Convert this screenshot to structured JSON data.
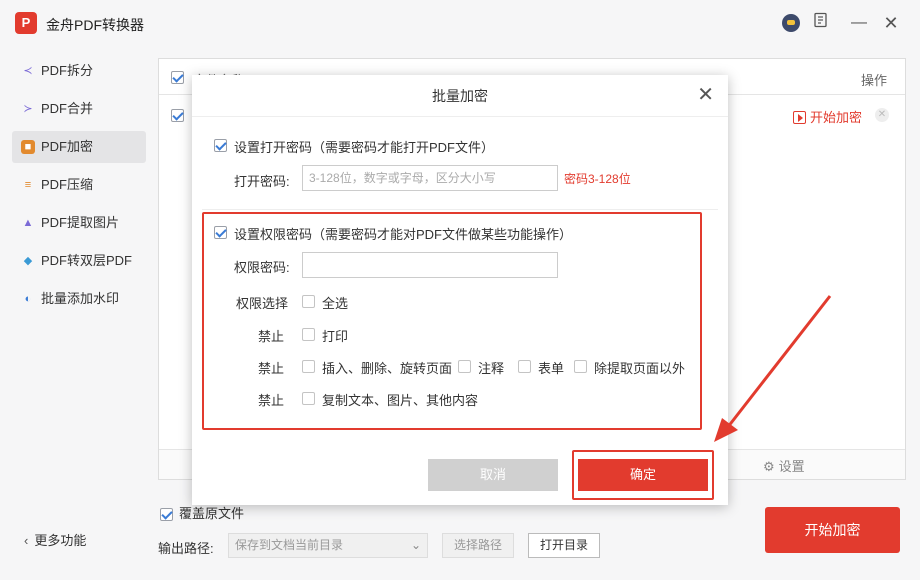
{
  "app": {
    "title": "金舟PDF转换器",
    "logo_text": "P"
  },
  "titlebar": {
    "min_glyph": "—",
    "close_glyph": "✕"
  },
  "sidebar": {
    "items": [
      {
        "label": "PDF拆分",
        "icon": "split-icon",
        "color": "#7b6ad6"
      },
      {
        "label": "PDF合并",
        "icon": "merge-icon",
        "color": "#7b6ad6"
      },
      {
        "label": "PDF加密",
        "icon": "encrypt-icon",
        "color": "#e28a2e"
      },
      {
        "label": "PDF压缩",
        "icon": "compress-icon",
        "color": "#e28a2e"
      },
      {
        "label": "PDF提取图片",
        "icon": "extract-image-icon",
        "color": "#7b6ad6"
      },
      {
        "label": "PDF转双层PDF",
        "icon": "layers-icon",
        "color": "#3a9ad5"
      },
      {
        "label": "批量添加水印",
        "icon": "watermark-icon",
        "color": "#3a7bd5"
      }
    ],
    "active_index": 2,
    "more": "更多功能"
  },
  "filelist": {
    "col_name": "文件名称",
    "col_op": "操作",
    "row_action": "开始加密",
    "settings": "设置"
  },
  "bottom": {
    "overwrite": "覆盖原文件",
    "output_label": "输出路径:",
    "output_value": "保存到文档当前目录",
    "browse": "选择路径",
    "open_dir": "打开目录",
    "start": "开始加密"
  },
  "modal": {
    "title": "批量加密",
    "open_pw_check": "设置打开密码（需要密码才能打开PDF文件）",
    "open_pw_label": "打开密码:",
    "open_pw_placeholder": "3-128位，数字或字母，区分大小写",
    "open_pw_hint": "密码3-128位",
    "perm_check": "设置权限密码（需要密码才能对PDF文件做某些功能操作）",
    "perm_pw_label": "权限密码:",
    "perm_select_label": "权限选择",
    "select_all": "全选",
    "forbid": "禁止",
    "print": "打印",
    "insert_delete_rotate": "插入、删除、旋转页面",
    "annotate": "注释",
    "form": "表单",
    "except_extract": "除提取页面以外",
    "copy_content": "复制文本、图片、其他内容",
    "cancel": "取消",
    "ok": "确定"
  },
  "colors": {
    "accent": "#e23b2e",
    "check": "#3a7bd5"
  }
}
